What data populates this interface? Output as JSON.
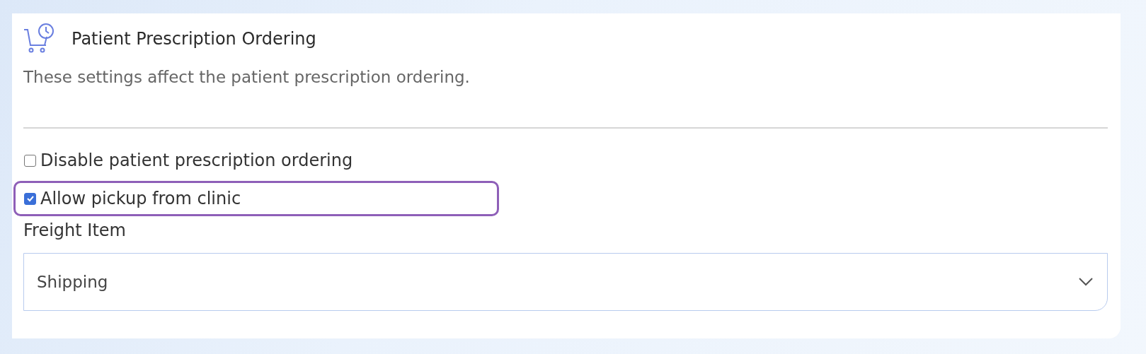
{
  "section": {
    "title": "Patient Prescription Ordering",
    "description": "These settings affect the patient prescription ordering."
  },
  "options": [
    {
      "label": "Disable patient prescription ordering",
      "checked": false,
      "highlighted": false
    },
    {
      "label": "Allow pickup from clinic",
      "checked": true,
      "highlighted": true
    }
  ],
  "freight": {
    "label": "Freight Item",
    "value": "Shipping"
  }
}
